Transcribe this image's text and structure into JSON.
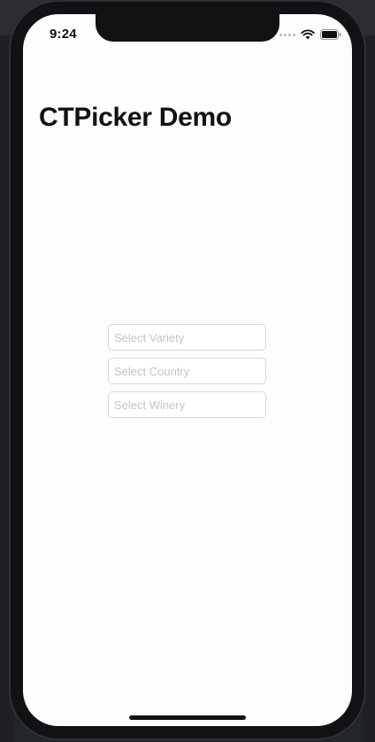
{
  "status_bar": {
    "time": "9:24",
    "icons": [
      "signal-dots-icon",
      "wifi-icon",
      "battery-icon"
    ]
  },
  "nav": {
    "title": "CTPicker Demo"
  },
  "pickers": [
    {
      "placeholder": "Select Variety",
      "value": ""
    },
    {
      "placeholder": "Select Country",
      "value": ""
    },
    {
      "placeholder": "Select Winery",
      "value": ""
    }
  ],
  "colors": {
    "background": "#fdfdfc",
    "field_border": "#d8d8d8",
    "placeholder": "#c4c4c4",
    "device_frame": "#111214"
  }
}
